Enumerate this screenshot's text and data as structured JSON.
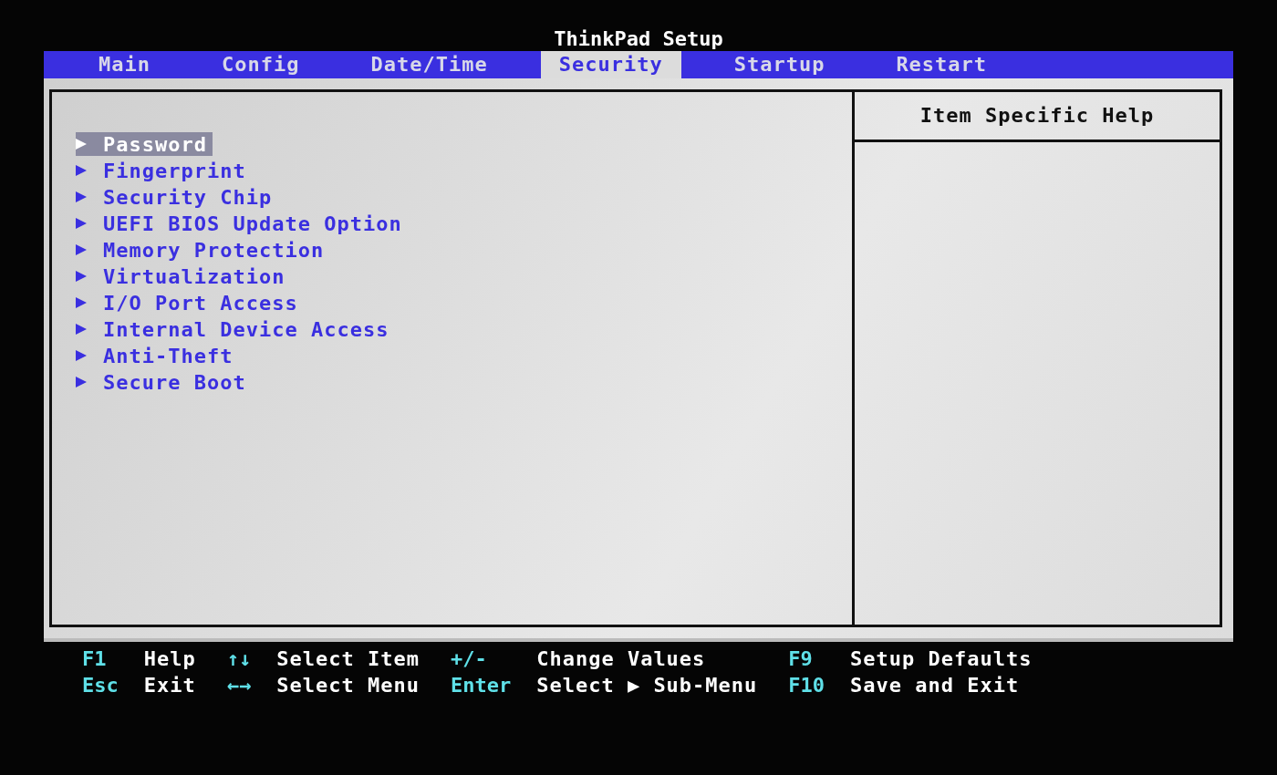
{
  "title": "ThinkPad Setup",
  "tabs": [
    {
      "label": "Main",
      "selected": false
    },
    {
      "label": "Config",
      "selected": false
    },
    {
      "label": "Date/Time",
      "selected": false
    },
    {
      "label": "Security",
      "selected": true
    },
    {
      "label": "Startup",
      "selected": false
    },
    {
      "label": "Restart",
      "selected": false
    }
  ],
  "menu": {
    "items": [
      {
        "label": "Password",
        "selected": true
      },
      {
        "label": "Fingerprint",
        "selected": false
      },
      {
        "label": "Security Chip",
        "selected": false
      },
      {
        "label": "UEFI BIOS Update Option",
        "selected": false
      },
      {
        "label": "Memory Protection",
        "selected": false
      },
      {
        "label": "Virtualization",
        "selected": false
      },
      {
        "label": "I/O Port Access",
        "selected": false
      },
      {
        "label": "Internal Device Access",
        "selected": false
      },
      {
        "label": "Anti-Theft",
        "selected": false
      },
      {
        "label": "Secure Boot",
        "selected": false
      }
    ]
  },
  "help_panel": {
    "title": "Item Specific Help"
  },
  "footer": {
    "groups": [
      [
        {
          "key": "F1",
          "action": "Help"
        },
        {
          "key": "Esc",
          "action": "Exit"
        }
      ],
      [
        {
          "key": "↑↓",
          "action": "Select Item"
        },
        {
          "key": "←→",
          "action": "Select Menu"
        }
      ],
      [
        {
          "key": "+/-",
          "action": "Change Values"
        },
        {
          "key": "Enter",
          "action": "Select ▶ Sub-Menu"
        }
      ],
      [
        {
          "key": "F9",
          "action": "Setup Defaults"
        },
        {
          "key": "F10",
          "action": "Save and Exit"
        }
      ]
    ]
  }
}
